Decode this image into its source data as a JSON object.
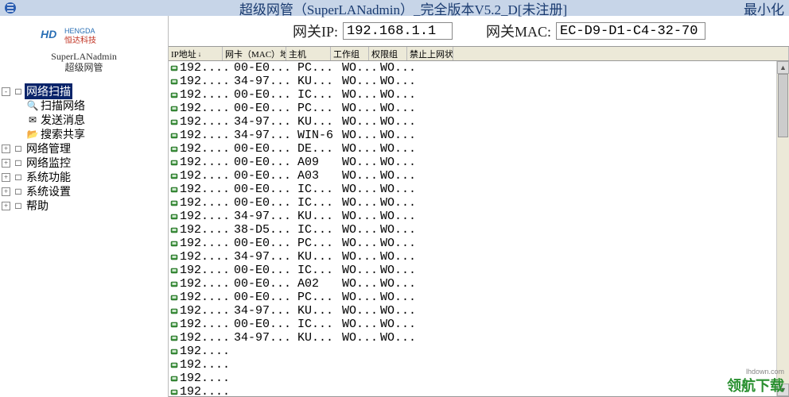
{
  "titlebar": {
    "title": "超级网管（SuperLANadmin）_完全版本V5.2_D[未注册]",
    "minimize": "最小化"
  },
  "sidebar": {
    "logo_brand": "HENGDA",
    "logo_sub": "恒达科技",
    "app_en": "SuperLANadmin",
    "app_zh": "超级网管",
    "tree": [
      {
        "toggle": "-",
        "icon": "□",
        "label": "网络扫描",
        "selected": true,
        "children": [
          {
            "icon": "🔍",
            "label": "扫描网络"
          },
          {
            "icon": "✉",
            "label": "发送消息"
          },
          {
            "icon": "📂",
            "label": "搜索共享"
          }
        ]
      },
      {
        "toggle": "+",
        "icon": "□",
        "label": "网络管理"
      },
      {
        "toggle": "+",
        "icon": "□",
        "label": "网络监控"
      },
      {
        "toggle": "+",
        "icon": "□",
        "label": "系统功能"
      },
      {
        "toggle": "+",
        "icon": "□",
        "label": "系统设置"
      },
      {
        "toggle": "+",
        "icon": "□",
        "label": "帮助"
      }
    ]
  },
  "gateway": {
    "ip_label": "网关IP:",
    "ip_value": "192.168.1.1",
    "mac_label": "网关MAC:",
    "mac_value": "EC-D9-D1-C4-32-70"
  },
  "columns": {
    "ip": "IP地址",
    "mac": "网卡（MAC）地址",
    "host": "主机",
    "workgroup": "工作组",
    "group": "权限组",
    "netstat": "禁止上网状态"
  },
  "rows": [
    {
      "ip": "192....",
      "mac": "00-E0...",
      "host": "PC...",
      "wg": "WO...",
      "grp": "WO..."
    },
    {
      "ip": "192....",
      "mac": "34-97...",
      "host": "KU...",
      "wg": "WO...",
      "grp": "WO..."
    },
    {
      "ip": "192....",
      "mac": "00-E0...",
      "host": "IC...",
      "wg": "WO...",
      "grp": "WO..."
    },
    {
      "ip": "192....",
      "mac": "00-E0...",
      "host": "PC...",
      "wg": "WO...",
      "grp": "WO..."
    },
    {
      "ip": "192....",
      "mac": "34-97...",
      "host": "KU...",
      "wg": "WO...",
      "grp": "WO..."
    },
    {
      "ip": "192....",
      "mac": "34-97...",
      "host": "WIN-6",
      "wg": "WO...",
      "grp": "WO..."
    },
    {
      "ip": "192....",
      "mac": "00-E0...",
      "host": "DE...",
      "wg": "WO...",
      "grp": "WO..."
    },
    {
      "ip": "192....",
      "mac": "00-E0...",
      "host": "A09",
      "wg": "WO...",
      "grp": "WO..."
    },
    {
      "ip": "192....",
      "mac": "00-E0...",
      "host": "A03",
      "wg": "WO...",
      "grp": "WO..."
    },
    {
      "ip": "192....",
      "mac": "00-E0...",
      "host": "IC...",
      "wg": "WO...",
      "grp": "WO..."
    },
    {
      "ip": "192....",
      "mac": "00-E0...",
      "host": "IC...",
      "wg": "WO...",
      "grp": "WO..."
    },
    {
      "ip": "192....",
      "mac": "34-97...",
      "host": "KU...",
      "wg": "WO...",
      "grp": "WO..."
    },
    {
      "ip": "192....",
      "mac": "38-D5...",
      "host": "IC...",
      "wg": "WO...",
      "grp": "WO..."
    },
    {
      "ip": "192....",
      "mac": "00-E0...",
      "host": "PC...",
      "wg": "WO...",
      "grp": "WO..."
    },
    {
      "ip": "192....",
      "mac": "34-97...",
      "host": "KU...",
      "wg": "WO...",
      "grp": "WO..."
    },
    {
      "ip": "192....",
      "mac": "00-E0...",
      "host": "IC...",
      "wg": "WO...",
      "grp": "WO..."
    },
    {
      "ip": "192....",
      "mac": "00-E0...",
      "host": "A02",
      "wg": "WO...",
      "grp": "WO..."
    },
    {
      "ip": "192....",
      "mac": "00-E0...",
      "host": "PC...",
      "wg": "WO...",
      "grp": "WO..."
    },
    {
      "ip": "192....",
      "mac": "34-97...",
      "host": "KU...",
      "wg": "WO...",
      "grp": "WO..."
    },
    {
      "ip": "192....",
      "mac": "00-E0...",
      "host": "IC...",
      "wg": "WO...",
      "grp": "WO..."
    },
    {
      "ip": "192....",
      "mac": "34-97...",
      "host": "KU...",
      "wg": "WO...",
      "grp": "WO..."
    },
    {
      "ip": "192....",
      "mac": "",
      "host": "",
      "wg": "",
      "grp": ""
    },
    {
      "ip": "192....",
      "mac": "",
      "host": "",
      "wg": "",
      "grp": ""
    },
    {
      "ip": "192....",
      "mac": "",
      "host": "",
      "wg": "",
      "grp": ""
    },
    {
      "ip": "192....",
      "mac": "",
      "host": "",
      "wg": "",
      "grp": ""
    }
  ],
  "watermark": {
    "main": "领航下载",
    "sub": "lhdown.com"
  }
}
